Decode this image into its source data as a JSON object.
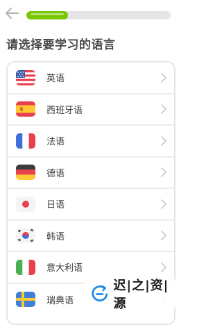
{
  "page": {
    "title": "请选择要学习的语言",
    "progress_percent": 29
  },
  "languages": [
    {
      "label": "英语",
      "flag_icon": "us-flag-icon"
    },
    {
      "label": "西班牙语",
      "flag_icon": "spain-flag-icon"
    },
    {
      "label": "法语",
      "flag_icon": "france-flag-icon"
    },
    {
      "label": "德语",
      "flag_icon": "germany-flag-icon"
    },
    {
      "label": "日语",
      "flag_icon": "japan-flag-icon"
    },
    {
      "label": "韩语",
      "flag_icon": "korea-flag-icon"
    },
    {
      "label": "意大利语",
      "flag_icon": "italy-flag-icon"
    },
    {
      "label": "瑞典语",
      "flag_icon": "sweden-flag-icon"
    }
  ],
  "watermark": {
    "text": "迟|之|资|源"
  },
  "colors": {
    "progress": "#78c800",
    "track": "#e5e5e5",
    "border": "#e5e5e5",
    "chevron": "#c8c8c8"
  }
}
